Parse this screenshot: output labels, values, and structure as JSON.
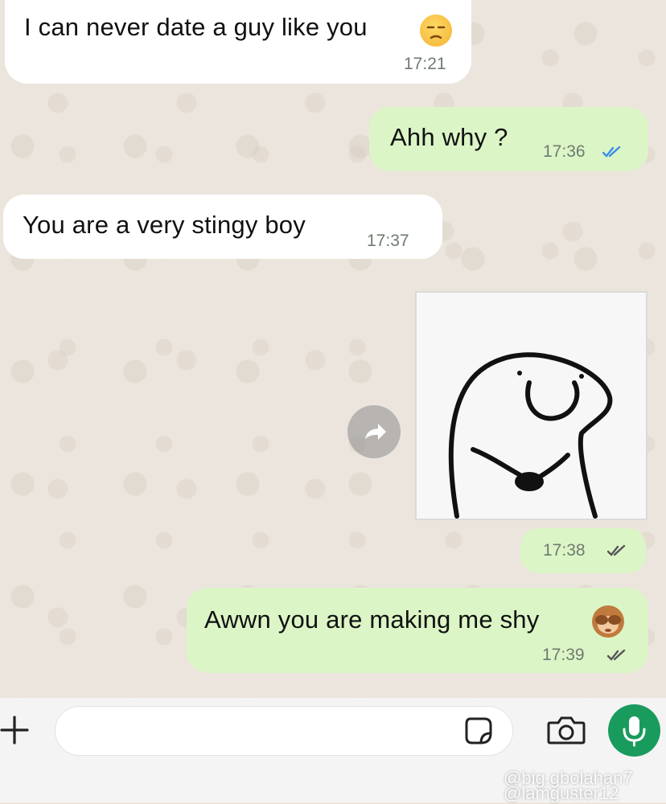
{
  "messages": [
    {
      "direction": "incoming",
      "text": "I can never date a guy like you",
      "time": "17:21",
      "emoji": "unamused-face-emoji"
    },
    {
      "direction": "outgoing",
      "text": "Ahh why ?",
      "time": "17:36",
      "status": "read"
    },
    {
      "direction": "incoming",
      "text": "You are a very stingy boy",
      "time": "17:37"
    },
    {
      "direction": "outgoing",
      "type": "sticker",
      "sticker": "shy-blob-sticker",
      "time": "17:38",
      "status": "delivered"
    },
    {
      "direction": "outgoing",
      "text": "Awwn you are making me shy",
      "time": "17:39",
      "status": "delivered",
      "emoji": "see-no-evil-monkey-emoji"
    }
  ],
  "colors": {
    "incoming_bubble": "#ffffff",
    "outgoing_bubble": "#dcf5c6",
    "read_tick": "#3b8de8",
    "delivered_tick": "#555555",
    "mic_button": "#1a9b5e"
  },
  "input": {
    "placeholder": "",
    "icons": {
      "plus": "plus-icon",
      "sticker": "sticker-icon",
      "camera": "camera-icon",
      "mic": "microphone-icon"
    }
  },
  "watermark": {
    "line1": "@big.gbolahan7",
    "line2": "@lamguster12"
  }
}
